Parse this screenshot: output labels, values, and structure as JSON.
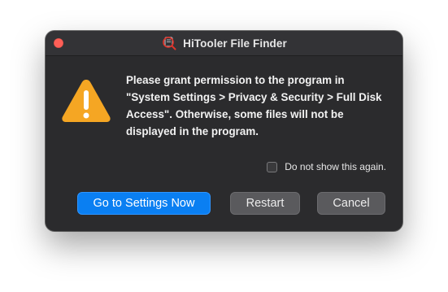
{
  "window": {
    "title": "HiTooler File Finder"
  },
  "dialog": {
    "icon": "warning-icon",
    "message": "Please grant permission to the program in \"System Settings > Privacy & Security > Full Disk Access\". Otherwise, some files will not be displayed in the program.",
    "checkbox": {
      "label": "Do not show this again.",
      "checked": false
    },
    "buttons": {
      "primary": "Go to Settings Now",
      "restart": "Restart",
      "cancel": "Cancel"
    }
  },
  "colors": {
    "primary_button": "#0a7ff2",
    "warning": "#f5a623",
    "close": "#ff5f57"
  }
}
